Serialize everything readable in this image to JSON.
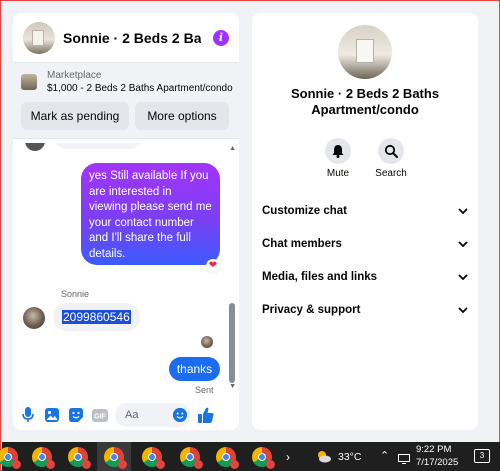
{
  "chat": {
    "title": "Sonnie · 2 Beds 2 Baths Apartment/condo",
    "listing": {
      "label": "Marketplace",
      "value": "$1,000 - 2 Beds 2 Baths Apartment/condo",
      "pending_label": "Mark as pending",
      "more_label": "More options"
    },
    "messages": {
      "outgoing_long": "yes Still available If you are interested in viewing please send me your contact number and I'll share the full details.",
      "sender_name": "Sonnie",
      "incoming_number": "2099860546",
      "outgoing_short": "thanks",
      "sent_status": "Sent",
      "heart_reaction": "❤"
    },
    "composer": {
      "placeholder": "Aa"
    }
  },
  "info": {
    "title": "Sonnie · 2 Beds 2 Baths Apartment/condo",
    "actions": [
      {
        "label": "Mute",
        "icon": "bell-icon"
      },
      {
        "label": "Search",
        "icon": "search-icon"
      }
    ],
    "menu": [
      "Customize chat",
      "Chat members",
      "Media, files and links",
      "Privacy & support"
    ]
  },
  "taskbar": {
    "weather": "33°C",
    "time": "9:22 PM",
    "date": "7/17/2025",
    "notification_count": "3"
  },
  "colors": {
    "accent": "#1b6cf0",
    "info_icon": "#a033ff",
    "bubble_gradient_top": "#a334fa",
    "bubble_gradient_bottom": "#3b5bff"
  }
}
